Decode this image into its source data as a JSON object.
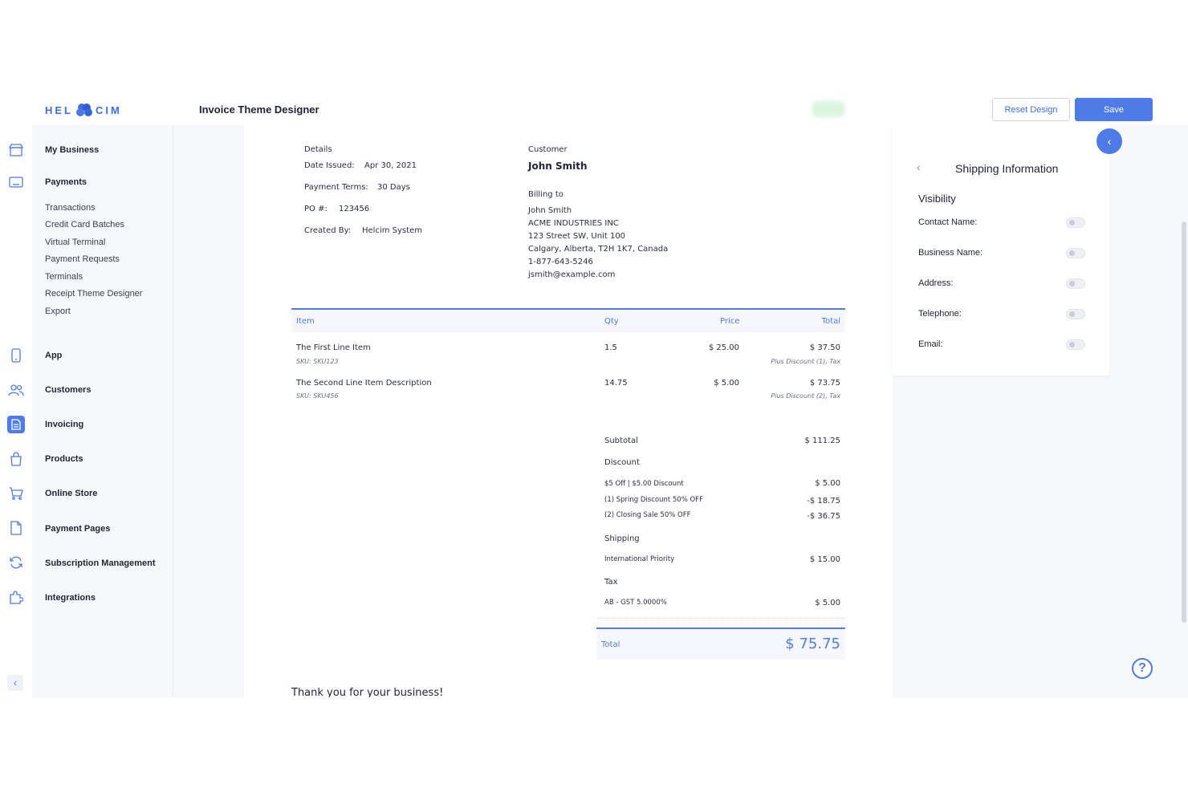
{
  "app": {
    "logo_text_left": "HEL",
    "logo_text_right": "CIM",
    "title": "Invoice Theme Designer",
    "reset_label": "Reset Design",
    "save_label": "Save"
  },
  "rail_icons": [
    "store-icon",
    "terminal-icon",
    "phone-icon",
    "customers-icon",
    "invoice-icon",
    "bag-icon",
    "cart-icon",
    "page-icon",
    "refresh-icon",
    "puzzle-icon"
  ],
  "sidebar": {
    "my_business": "My Business",
    "payments": "Payments",
    "payment_items": [
      "Transactions",
      "Credit Card Batches",
      "Virtual Terminal",
      "Payment Requests",
      "Terminals",
      "Receipt Theme Designer",
      "Export"
    ],
    "sections": [
      "App",
      "Customers",
      "Invoicing",
      "Products",
      "Online Store",
      "Payment Pages",
      "Subscription Management",
      "Integrations"
    ]
  },
  "invoice": {
    "details_title": "Details",
    "date_issued_label": "Date Issued:",
    "date_issued": "Apr 30, 2021",
    "terms_label": "Payment Terms:",
    "terms": "30 Days",
    "po_label": "PO #:",
    "po": "123456",
    "created_by_label": "Created By:",
    "created_by": "Helcim System",
    "customer_title": "Customer",
    "customer_name": "John Smith",
    "billing_title": "Billing to",
    "billing_lines": [
      "John Smith",
      "ACME INDUSTRIES INC",
      "123 Street SW, Unit 100",
      "Calgary, Alberta, T2H 1K7, Canada",
      "1-877-643-5246",
      "jsmith@example.com"
    ],
    "headers": {
      "item": "Item",
      "qty": "Qty",
      "price": "Price",
      "total": "Total"
    },
    "items": [
      {
        "name": "The First Line Item",
        "sku": "SKU: SKU123",
        "qty": "1.5",
        "price": "$ 25.00",
        "total": "$ 37.50",
        "note": "Plus Discount (1), Tax"
      },
      {
        "name": "The Second Line Item Description",
        "sku": "SKU: SKU456",
        "qty": "14.75",
        "price": "$ 5.00",
        "total": "$ 73.75",
        "note": "Plus Discount (2), Tax"
      }
    ],
    "subtotal_label": "Subtotal",
    "subtotal": "$ 111.25",
    "discount_label": "Discount",
    "discounts": [
      {
        "label": "$5 Off | $5.00 Discount",
        "value": "$ 5.00"
      },
      {
        "label": "(1) Spring Discount 50% OFF",
        "value": "-$ 18.75"
      },
      {
        "label": "(2) Closing Sale 50% OFF",
        "value": "-$ 36.75"
      }
    ],
    "shipping_label": "Shipping",
    "shipping_line": "International Priority",
    "shipping_value": "$ 15.00",
    "tax_label": "Tax",
    "tax_line": "AB - GST 5.0000%",
    "tax_value": "$ 5.00",
    "total_label": "Total",
    "total_value": "$ 75.75",
    "thanks": "Thank you for your business!"
  },
  "panel": {
    "title": "Shipping Information",
    "visibility_title": "Visibility",
    "fields": [
      "Contact Name:",
      "Business Name:",
      "Address:",
      "Telephone:",
      "Email:"
    ],
    "toggles_on": [
      false,
      false,
      false,
      false,
      false
    ]
  },
  "colors": {
    "accent": "#4f7be8",
    "nav_bg": "#f7f8fb"
  }
}
